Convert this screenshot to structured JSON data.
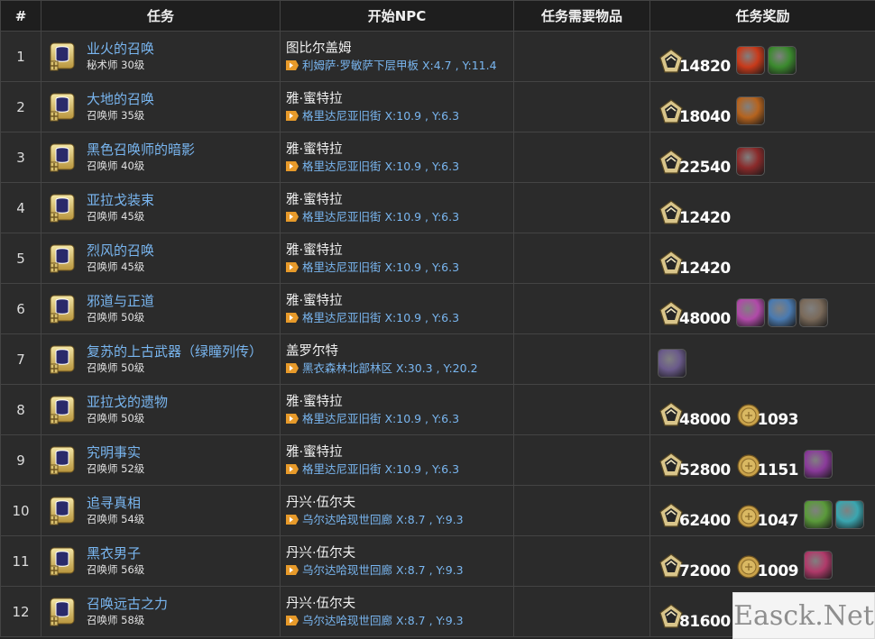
{
  "headers": [
    "#",
    "任务",
    "开始NPC",
    "任务需要物品",
    "任务奖励"
  ],
  "rows": [
    {
      "num": "1",
      "name": "业火的召唤",
      "level": "秘术师 30级",
      "npc": "图比尔盖姆",
      "loc": "利姆萨·罗敏萨下层甲板 X:4.7 , Y:11.4",
      "exp": "14820",
      "gil": "",
      "items": [
        "#c83a1a",
        "#3b8a2e"
      ]
    },
    {
      "num": "2",
      "name": "大地的召唤",
      "level": "召唤师 35级",
      "npc": "雅·蜜特拉",
      "loc": "格里达尼亚旧街 X:10.9 , Y:6.3",
      "exp": "18040",
      "gil": "",
      "items": [
        "#b5631e"
      ]
    },
    {
      "num": "3",
      "name": "黑色召唤师的暗影",
      "level": "召唤师 40级",
      "npc": "雅·蜜特拉",
      "loc": "格里达尼亚旧街 X:10.9 , Y:6.3",
      "exp": "22540",
      "gil": "",
      "items": [
        "#8a2a2a"
      ]
    },
    {
      "num": "4",
      "name": "亚拉戈装束",
      "level": "召唤师 45级",
      "npc": "雅·蜜特拉",
      "loc": "格里达尼亚旧街 X:10.9 , Y:6.3",
      "exp": "12420",
      "gil": "",
      "items": []
    },
    {
      "num": "5",
      "name": "烈风的召唤",
      "level": "召唤师 45级",
      "npc": "雅·蜜特拉",
      "loc": "格里达尼亚旧街 X:10.9 , Y:6.3",
      "exp": "12420",
      "gil": "",
      "items": []
    },
    {
      "num": "6",
      "name": "邪道与正道",
      "level": "召唤师 50级",
      "npc": "雅·蜜特拉",
      "loc": "格里达尼亚旧街 X:10.9 , Y:6.3",
      "exp": "48000",
      "gil": "",
      "items": [
        "#b04aa8",
        "#4a7ab0",
        "#7a6a5a"
      ]
    },
    {
      "num": "7",
      "name": "复苏的上古武器（绿瞳列传）",
      "level": "召唤师 50级",
      "npc": "盖罗尔特",
      "loc": "黑衣森林北部林区 X:30.3 , Y:20.2",
      "exp": "",
      "gil": "",
      "items": [
        "#6a5a8a"
      ]
    },
    {
      "num": "8",
      "name": "亚拉戈的遗物",
      "level": "召唤师 50级",
      "npc": "雅·蜜特拉",
      "loc": "格里达尼亚旧街 X:10.9 , Y:6.3",
      "exp": "48000",
      "gil": "1093",
      "items": []
    },
    {
      "num": "9",
      "name": "究明事实",
      "level": "召唤师 52级",
      "npc": "雅·蜜特拉",
      "loc": "格里达尼亚旧街 X:10.9 , Y:6.3",
      "exp": "52800",
      "gil": "1151",
      "items": [
        "#8a3a9a"
      ]
    },
    {
      "num": "10",
      "name": "追寻真相",
      "level": "召唤师 54级",
      "npc": "丹兴·伍尔夫",
      "loc": "乌尔达哈现世回廊 X:8.7 , Y:9.3",
      "exp": "62400",
      "gil": "1047",
      "items": [
        "#5a9a3a",
        "#3aa6b0"
      ]
    },
    {
      "num": "11",
      "name": "黑衣男子",
      "level": "召唤师 56级",
      "npc": "丹兴·伍尔夫",
      "loc": "乌尔达哈现世回廊 X:8.7 , Y:9.3",
      "exp": "72000",
      "gil": "1009",
      "items": [
        "#b03a6a"
      ]
    },
    {
      "num": "12",
      "name": "召唤远古之力",
      "level": "召唤师 58级",
      "npc": "丹兴·伍尔夫",
      "loc": "乌尔达哈现世回廊 X:8.7 , Y:9.3",
      "exp": "81600",
      "gil": "",
      "items": []
    }
  ],
  "watermark": "Easck.Net"
}
